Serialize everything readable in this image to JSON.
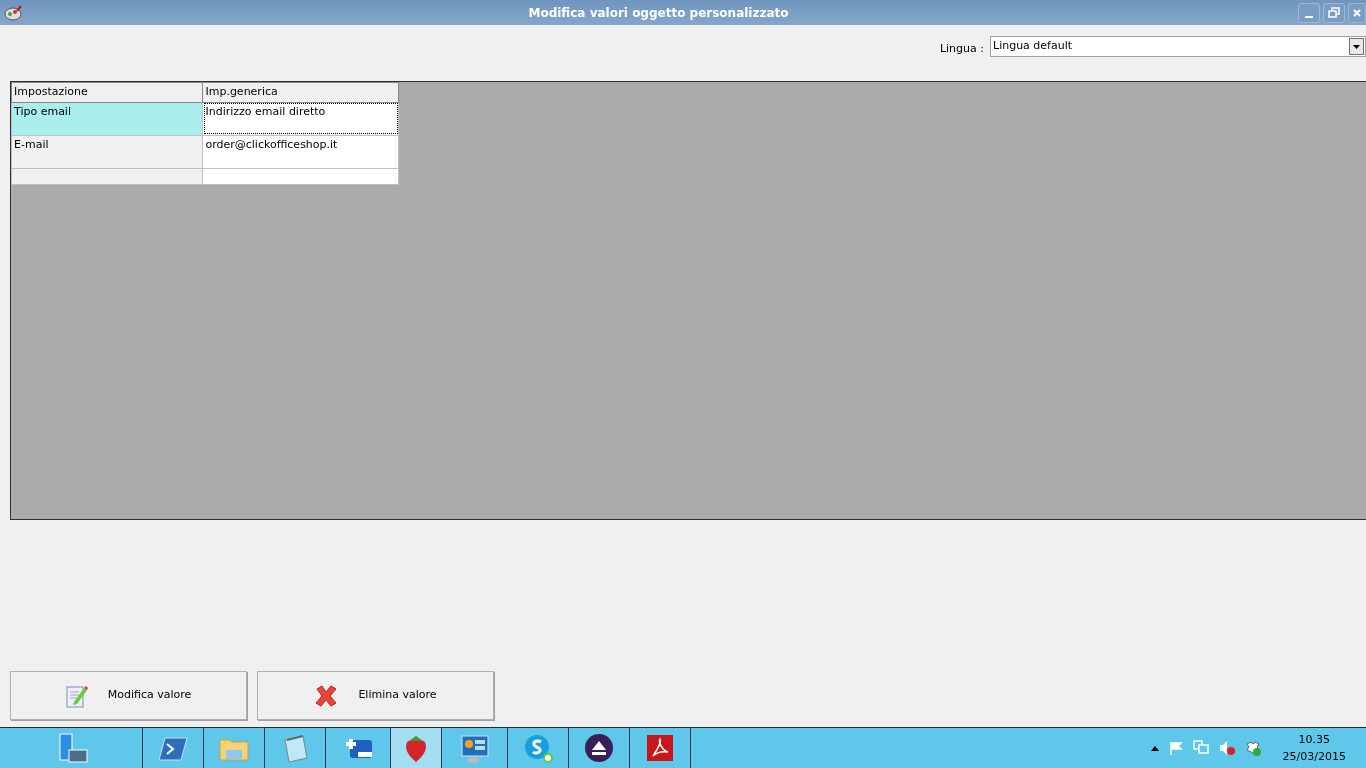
{
  "window": {
    "title": "Modifica valori oggetto personalizzato"
  },
  "language": {
    "label": "Lingua :",
    "value": "Lingua default"
  },
  "table": {
    "columns": [
      "Impostazione",
      "Imp.generica"
    ],
    "rows": [
      {
        "setting": "Tipo email",
        "value": "Indirizzo email diretto",
        "selected": true
      },
      {
        "setting": "E-mail",
        "value": "order@clickofficeshop.it",
        "selected": false
      },
      {
        "setting": "",
        "value": "",
        "selected": false
      }
    ]
  },
  "buttons": [
    {
      "kind": "edit",
      "label": "Modifica valore"
    },
    {
      "kind": "delete",
      "label": "Elimina valore"
    }
  ],
  "taskbar": {
    "items": [
      {
        "kind": "server",
        "active": false
      },
      {
        "kind": "shell",
        "active": false
      },
      {
        "kind": "folder",
        "active": false
      },
      {
        "kind": "notepad",
        "active": false
      },
      {
        "kind": "plusminus",
        "active": false
      },
      {
        "kind": "strawberry",
        "active": true
      },
      {
        "kind": "panel",
        "active": false
      },
      {
        "kind": "chat",
        "active": false
      },
      {
        "kind": "eject",
        "active": false
      },
      {
        "kind": "pdf",
        "active": false
      }
    ],
    "time": "10.35",
    "date": "25/03/2015"
  }
}
